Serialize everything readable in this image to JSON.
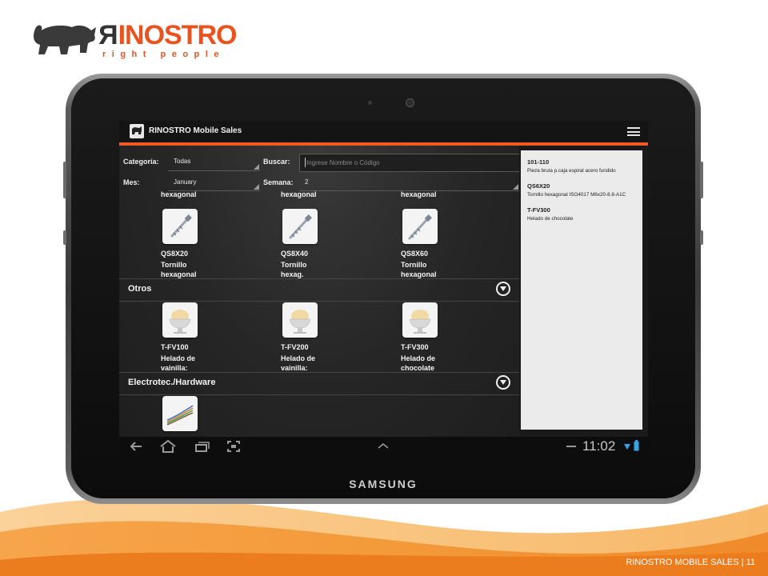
{
  "slide": {
    "logo_wordmark": "RINOSTRO",
    "logo_tagline": "right people",
    "footer_label": "RINOSTRO MOBILE SALES",
    "footer_separator": "|",
    "page_number": "11",
    "brand_color": "#e9531f"
  },
  "device": {
    "brand": "SAMSUNG"
  },
  "app": {
    "title": "RINOSTRO Mobile Sales",
    "accent_color": "#f05a22",
    "icons": {
      "app": "rhino-logo-icon",
      "menu": "hamburger-menu-icon"
    }
  },
  "filters": {
    "categoria_label": "Categoría:",
    "categoria_value": "Todas",
    "mes_label": "Mes:",
    "mes_value": "January",
    "buscar_label": "Buscar:",
    "buscar_placeholder": "Ingrese Nombre o Código",
    "semana_label": "Semana:",
    "semana_value": "2"
  },
  "catalog": {
    "cut_row": [
      "hexagonal",
      "hexagonal",
      "hexagonal"
    ],
    "screws": [
      {
        "code": "QS8X20",
        "name_line1": "Tornillo",
        "name_line2": "hexagonal",
        "icon": "screw-icon"
      },
      {
        "code": "QS8X40",
        "name_line1": "Tornillo",
        "name_line2": "hexag.",
        "icon": "screw-icon"
      },
      {
        "code": "QS8X60",
        "name_line1": "Tornillo",
        "name_line2": "hexagonal",
        "icon": "screw-icon"
      }
    ],
    "sections": [
      {
        "title": "Otros",
        "icon": "chevron-down-circle-icon"
      },
      {
        "title": "Electrotec./Hardware",
        "icon": "chevron-down-circle-icon"
      }
    ],
    "otros": [
      {
        "code": "T-FV100",
        "name_line1": "Helado de",
        "name_line2": "vainilla:",
        "icon": "ice-cream-icon"
      },
      {
        "code": "T-FV200",
        "name_line1": "Helado de",
        "name_line2": "vainilla:",
        "icon": "ice-cream-icon"
      },
      {
        "code": "T-FV300",
        "name_line1": "Helado de",
        "name_line2": "chocolate",
        "icon": "ice-cream-icon"
      }
    ],
    "hardware_thumb_icon": "cable-icon"
  },
  "order_panel": {
    "items": [
      {
        "code": "101-110",
        "description": "Pieza bruta p.caja espiral acero fundido"
      },
      {
        "code": "QS6X20",
        "description": "Tornillo hexagonal ISO4017 M6x20-8.8-A1C"
      },
      {
        "code": "T-FV300",
        "description": "Helado de chocolate"
      }
    ]
  },
  "system_bar": {
    "time": "11:02",
    "icons": [
      "back-icon",
      "home-icon",
      "recent-apps-icon",
      "screenshot-icon",
      "chevron-up-icon",
      "wifi-icon",
      "battery-icon"
    ]
  }
}
